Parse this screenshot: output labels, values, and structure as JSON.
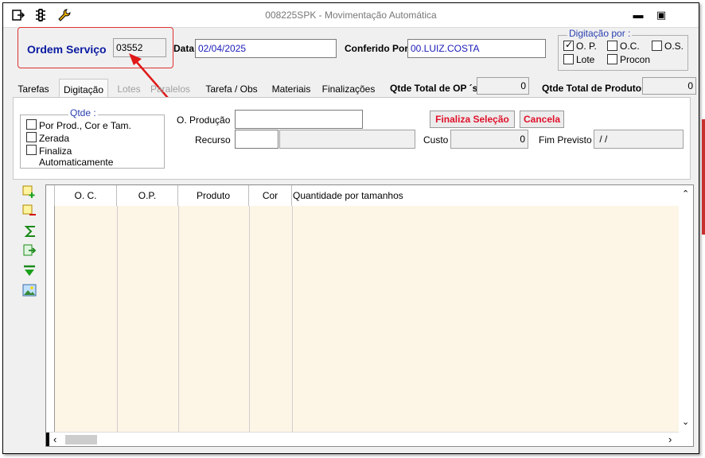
{
  "window": {
    "title": "008225SPK - Movimentação Automática",
    "minimize": "▬",
    "maximize": "▣"
  },
  "header": {
    "ordem_servico_label": "Ordem Serviço",
    "ordem_servico_value": "03552",
    "data_label": "Data",
    "data_value": "02/04/2025",
    "conferido_label": "Conferido Por",
    "conferido_value": "00.LUIZ.COSTA"
  },
  "digitacao_por": {
    "title": "Digitação por :",
    "options": [
      {
        "label": "O. P.",
        "checked": true
      },
      {
        "label": "O.C.",
        "checked": false
      },
      {
        "label": "O.S.",
        "checked": false
      },
      {
        "label": "Lote",
        "checked": false
      },
      {
        "label": "Procon",
        "checked": false
      }
    ]
  },
  "tabs": [
    {
      "label": "Tarefas",
      "state": "normal"
    },
    {
      "label": "Digitação",
      "state": "active"
    },
    {
      "label": "Lotes",
      "state": "disabled"
    },
    {
      "label": "Paralelos",
      "state": "disabled"
    },
    {
      "label": "Tarefa / Obs",
      "state": "normal"
    },
    {
      "label": "Materiais",
      "state": "normal"
    },
    {
      "label": "Finalizações",
      "state": "normal"
    }
  ],
  "totals": {
    "op_label": "Qtde Total de OP ´s",
    "op_value": "0",
    "produtos_label": "Qtde Total de Produtos",
    "produtos_value": "0"
  },
  "qtde": {
    "title": "Qtde :",
    "options": [
      {
        "label": "Por Prod., Cor e Tam.",
        "checked": false
      },
      {
        "label": "Zerada",
        "checked": false
      },
      {
        "label": "Finaliza",
        "checked": false
      }
    ],
    "finaliza_line2": "Automaticamente"
  },
  "form": {
    "producao_label": "O. Produção",
    "producao_value": "",
    "recurso_label": "Recurso",
    "recurso_code": "",
    "recurso_desc": "",
    "custo_label": "Custo",
    "custo_value": "0",
    "fim_label": "Fim Previsto",
    "fim_value": " / /"
  },
  "buttons": {
    "finaliza": "Finaliza Seleção",
    "cancela": "Cancela"
  },
  "grid": {
    "columns": [
      "O. C.",
      "O.P.",
      "Produto",
      "Cor",
      "Quantidade por tamanhos"
    ],
    "rows": []
  },
  "colors": {
    "accent_red": "#e0102a",
    "field_text": "#1a1ab8",
    "grid_bg": "#fdf5e6",
    "label_blue": "#0a1aa0"
  }
}
